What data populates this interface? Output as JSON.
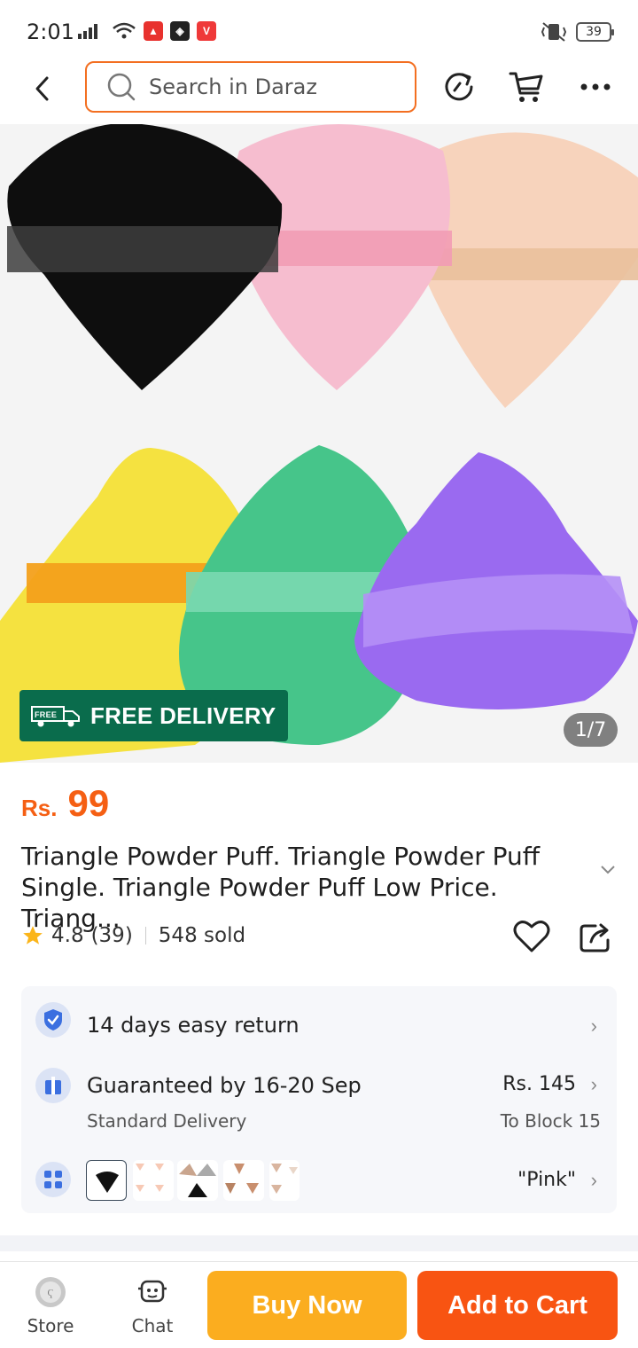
{
  "status_bar": {
    "time": "2:01",
    "battery": "39"
  },
  "header": {
    "search_placeholder": "Search in Daraz",
    "icons": [
      "back-icon",
      "search-icon",
      "refresh-icon",
      "cart-icon",
      "more-icon"
    ]
  },
  "hero": {
    "badge_label": "FREE DELIVERY",
    "badge_icon_text": "FREE",
    "image_counter": "1/7",
    "puff_colors": [
      "#0e0e0e",
      "#f7bfd0",
      "#f8d5be",
      "#f5e240",
      "#46c58a",
      "#9a6af0"
    ]
  },
  "product": {
    "price_currency": "Rs.",
    "price_value": "99",
    "title": "Triangle Powder Puff. Triangle Powder Puff Single. Triangle Powder Puff Low Price. Triang...",
    "rating": "4.8",
    "review_count": "(39)",
    "sold": "548 sold"
  },
  "info": {
    "return_text": "14 days easy return",
    "delivery_text": "Guaranteed by 16-20 Sep",
    "delivery_sub": "Standard Delivery",
    "delivery_price": "Rs. 145",
    "delivery_location": "To Block 15",
    "variant_selected": "\"Pink\""
  },
  "bottom_bar": {
    "store_label": "Store",
    "chat_label": "Chat",
    "buy_now_label": "Buy Now",
    "add_to_cart_label": "Add to Cart"
  },
  "colors": {
    "accent": "#f85412",
    "buy_now": "#fbad1f",
    "price": "#f55f13",
    "free_delivery": "#0a6c4c"
  }
}
